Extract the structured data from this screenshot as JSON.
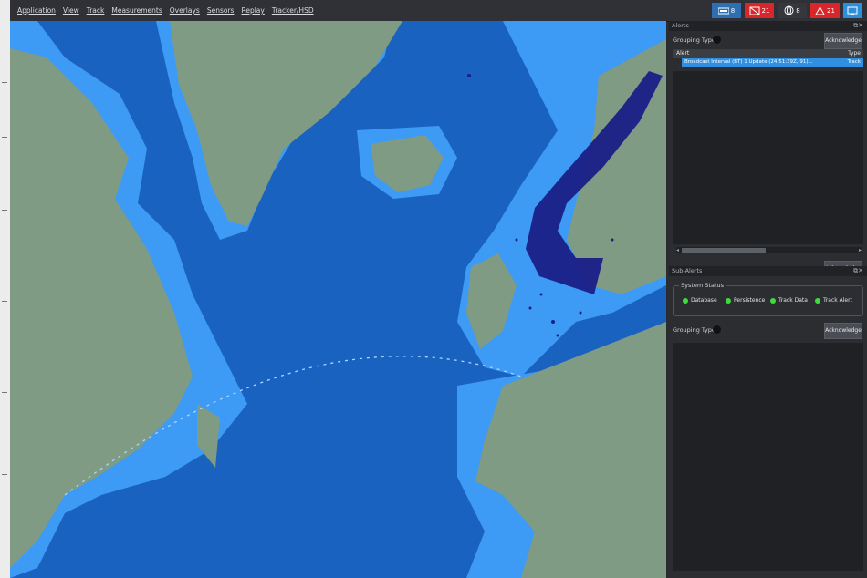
{
  "menu": [
    "Application",
    "View",
    "Track",
    "Measurements",
    "Overlays",
    "Sensors",
    "Replay",
    "Tracker/HSD"
  ],
  "status": [
    {
      "icon": "signal-icon",
      "label": "8",
      "color": "#2d6fb0"
    },
    {
      "icon": "alert-icon",
      "label": "21",
      "color": "#d9262b"
    },
    {
      "icon": "globe-icon",
      "label": "8",
      "color": "#35373c"
    },
    {
      "icon": "warning-icon",
      "label": "21",
      "color": "#d9262b"
    },
    {
      "icon": "monitor-icon",
      "label": "",
      "color": "#2d8fd8"
    }
  ],
  "alerts": {
    "title": "Alerts",
    "grouping_label": "Grouping Type",
    "ack_all_label": "Acknowledge",
    "col_alert": "Alert",
    "col_type": "Type",
    "row_text": "Broadcast Interval (BT) 1 Update (24:51:39Z, 91)...",
    "row_type": "Track",
    "acknowledge_label": "Acknowledge"
  },
  "system": {
    "title": "Sub-Alerts",
    "status_title": "System Status",
    "indicators": [
      "Database",
      "Persistence",
      "Track Data",
      "Track Alert"
    ],
    "grouping_label": "Grouping Type",
    "ack_all_label": "Acknowledge"
  },
  "colors": {
    "ocean": "#1a62c0",
    "shelf": "#3d9af5",
    "land": "#7f9b84",
    "track": "#1a1f86",
    "route": "#a8d6ff"
  }
}
